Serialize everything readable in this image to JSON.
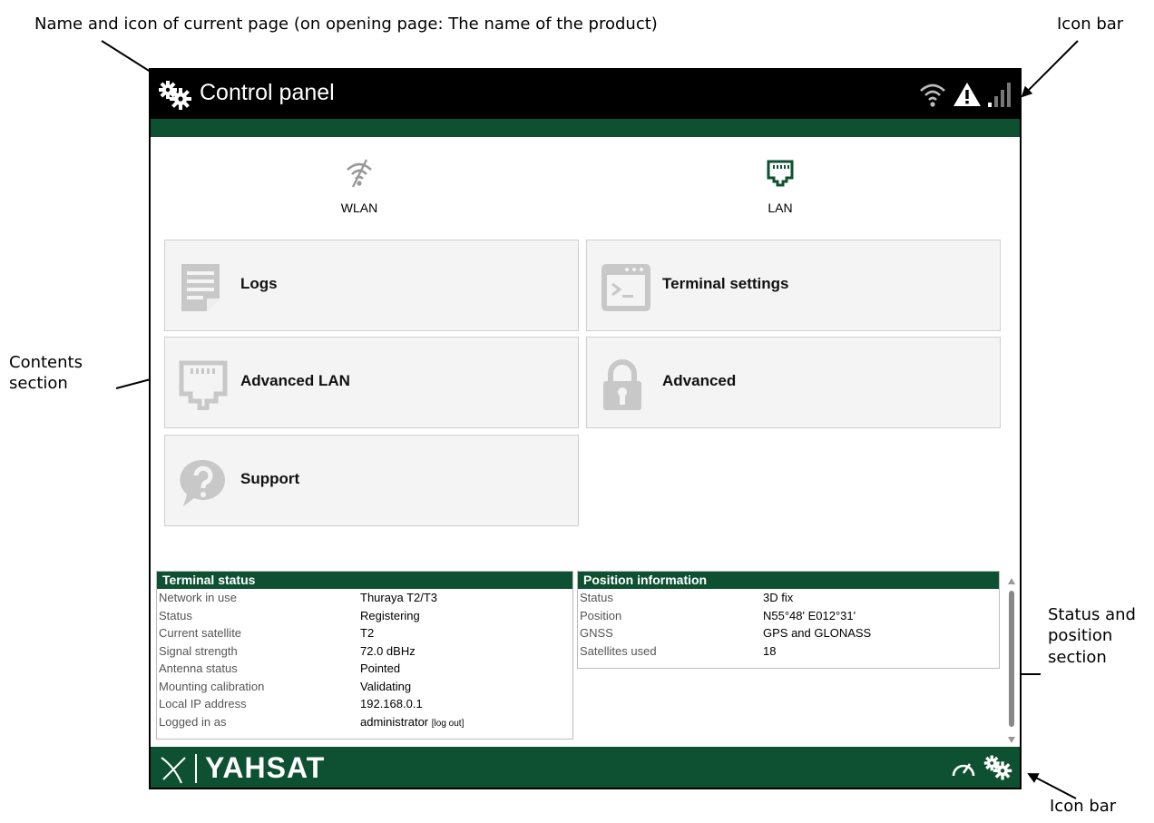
{
  "annotations": {
    "top_left": "Name and icon of current page (on opening page: The name of the product)",
    "top_right": "Icon bar",
    "contents": "Contents section",
    "status": "Status and position section",
    "bottom_right": "Icon bar"
  },
  "header": {
    "title": "Control panel",
    "title_icon": "gears-icon",
    "tray_icons": [
      "wifi-icon",
      "warning-icon",
      "signal-bars-icon"
    ]
  },
  "quick": {
    "wlan": "WLAN",
    "lan": "LAN"
  },
  "tiles": [
    {
      "label": "Logs",
      "icon": "logs-icon"
    },
    {
      "label": "Terminal settings",
      "icon": "terminal-icon"
    },
    {
      "label": "Advanced LAN",
      "icon": "lan-port-icon"
    },
    {
      "label": "Advanced",
      "icon": "lock-icon"
    },
    {
      "label": "Support",
      "icon": "help-bubble-icon"
    }
  ],
  "terminal_status": {
    "title": "Terminal status",
    "rows": [
      {
        "key": "Network in use",
        "value": "Thuraya T2/T3"
      },
      {
        "key": "Status",
        "value": "Registering"
      },
      {
        "key": "Current satellite",
        "value": "T2"
      },
      {
        "key": "Signal strength",
        "value": "72.0 dBHz"
      },
      {
        "key": "Antenna status",
        "value": "Pointed"
      },
      {
        "key": "Mounting calibration",
        "value": "Validating"
      },
      {
        "key": "Local IP address",
        "value": "192.168.0.1"
      },
      {
        "key": "Logged in as",
        "value": "administrator"
      }
    ],
    "logout": "[log out]"
  },
  "position": {
    "title": "Position information",
    "rows": [
      {
        "key": "Status",
        "value": "3D fix"
      },
      {
        "key": "Position",
        "value": "N55°48' E012°31'"
      },
      {
        "key": "GNSS",
        "value": "GPS and GLONASS"
      },
      {
        "key": "Satellites used",
        "value": "18"
      }
    ]
  },
  "footer": {
    "brand": "YAHSAT",
    "icons": [
      "speedometer-icon",
      "gears-icon"
    ]
  },
  "colors": {
    "brand_green": "#0e5132",
    "topbar": "#000000",
    "tile_bg": "#f4f4f4",
    "icon_gray": "#c8c8c8"
  }
}
